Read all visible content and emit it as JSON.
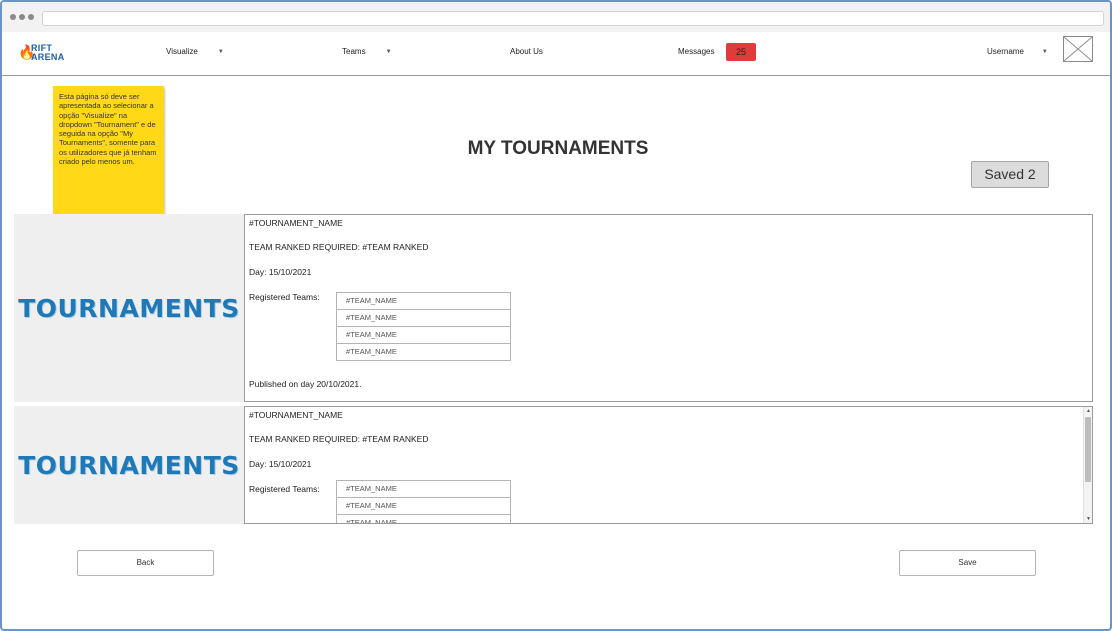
{
  "nav": {
    "logo_top": "RIFT",
    "logo_bottom": "ARENA",
    "visualize": "Visualize",
    "teams": "Teams",
    "about": "About Us",
    "messages": "Messages",
    "messages_count": "25",
    "username": "Username"
  },
  "sticky_note": "Esta página só deve ser apresentada ao selecionar a opção \"Visualize\" na dropdown \"Tournament\" e de seguida na opção  \"My Tournaments\", somente para os utilizadores que já tenham criado pelo menos um.",
  "page_title": "MY TOURNAMENTS",
  "saved_button": "Saved 2",
  "cards": [
    {
      "image_text": "TOURNAMENTS",
      "name": "#TOURNAMENT_NAME",
      "rank": "TEAM RANKED REQUIRED: #TEAM RANKED",
      "day": "Day: 15/10/2021",
      "registered_label": "Registered Teams:",
      "teams": [
        "#TEAM_NAME",
        "#TEAM_NAME",
        "#TEAM_NAME",
        "#TEAM_NAME"
      ],
      "published": "Published on day 20/10/2021."
    },
    {
      "image_text": "TOURNAMENTS",
      "name": "#TOURNAMENT_NAME",
      "rank": "TEAM RANKED REQUIRED: #TEAM RANKED",
      "day": "Day: 15/10/2021",
      "registered_label": "Registered Teams:",
      "teams": [
        "#TEAM_NAME",
        "#TEAM_NAME",
        "#TEAM_NAME"
      ]
    }
  ],
  "buttons": {
    "back": "Back",
    "save": "Save"
  },
  "colors": {
    "badge": "#e03b3b",
    "sticky": "#ffd918",
    "logo": "#1f5ea8",
    "tournaments_text": "#1d79b7"
  }
}
